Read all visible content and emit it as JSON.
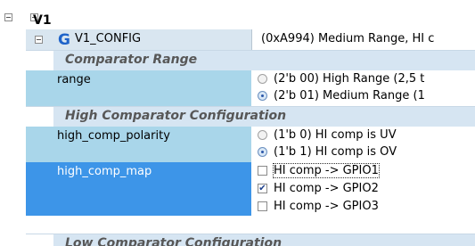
{
  "tree": {
    "root_label": "V1",
    "config": {
      "icon": "g-register-icon",
      "label": "V1_CONFIG",
      "value": "(0xA994) Medium Range, HI c"
    },
    "sections": [
      "Comparator Range",
      "High Comparator Configuration",
      "Low Comparator Configuration"
    ],
    "fields": {
      "range": {
        "label": "range",
        "options": [
          "(2'b 00) High Range (2,5 t",
          "(2'b 01) Medium Range (1"
        ],
        "selected_index": 1
      },
      "high_comp_polarity": {
        "label": "high_comp_polarity",
        "options": [
          "(1'b 0) HI comp is UV",
          "(1'b 1) HI comp is OV"
        ],
        "selected_index": 1
      },
      "high_comp_map": {
        "label": "high_comp_map",
        "options": [
          "HI comp -> GPIO1",
          "HI comp -> GPIO2",
          "HI comp -> GPIO3"
        ],
        "checked": [
          false,
          true,
          false
        ]
      }
    }
  },
  "colors": {
    "label_column": "#a9d6ea",
    "selected_row": "#3d95e8",
    "section_bg": "#d6e5f2",
    "config_label_bg": "#d9e6f0",
    "icon_blue": "#1e63c9"
  }
}
